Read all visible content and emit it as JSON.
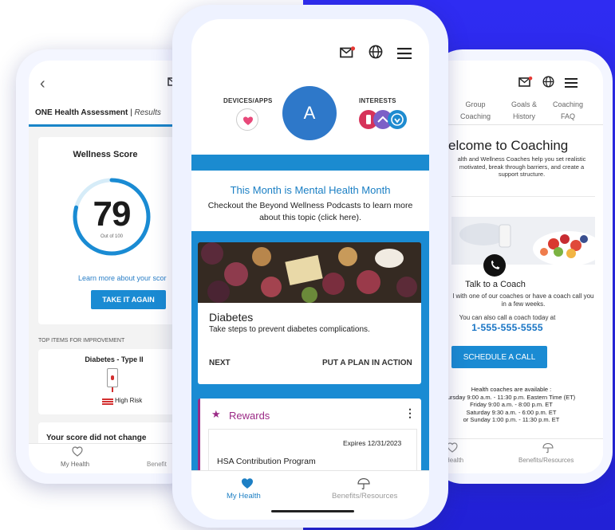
{
  "colors": {
    "brand_blue": "#1a8bd3",
    "background_blue": "#2f2cf2",
    "rewards_magenta": "#9b2a86",
    "risk_red": "#d32f2f"
  },
  "left_phone": {
    "title_main": "ONE Health Assessment",
    "title_sep": " | ",
    "title_sub": "Results",
    "wellness_title": "Wellness Score",
    "score": "79",
    "score_fraction": 0.79,
    "out_of": "Out of 100",
    "learn_more": "Learn more about your scor",
    "take_again": "TAKE IT AGAIN",
    "top_items": "TOP ITEMS FOR IMPROVEMENT",
    "diabetes_title": "Diabetes - Type II",
    "risk_label": "High Risk",
    "score_change": "Your score did not change",
    "nav": [
      "My Health",
      "Benefit"
    ]
  },
  "center_phone": {
    "devices_label": "DEVICES/APPS",
    "avatar_letter": "A",
    "interests_label": "INTERESTS",
    "month_title": "This Month is Mental Health Month",
    "month_desc": "Checkout the Beyond Wellness Podcasts to learn more about this topic (click here).",
    "card_title": "Diabetes",
    "card_desc": "Take steps to prevent diabetes complications.",
    "card_next": "NEXT",
    "card_plan": "PUT A PLAN IN ACTION",
    "rewards_title": "Rewards",
    "expires": "Expires 12/31/2023",
    "program": "HSA Contribution Program",
    "nav": [
      "My Health",
      "Benefits/Resources"
    ]
  },
  "right_phone": {
    "tabs": [
      [
        "Group",
        "Coaching"
      ],
      [
        "Goals &",
        "History"
      ],
      [
        "Coaching",
        "FAQ"
      ]
    ],
    "title": "elcome to Coaching",
    "desc": "alth and Wellness Coaches help you set realistic motivated, break through barriers, and create a support structure.",
    "talk_title": "Talk to a Coach",
    "talk_desc": "l with one of our coaches or have a coach call you in a few weeks.",
    "call_today": "You can also call a coach today at",
    "phone_number": "1-555-555-5555",
    "schedule": "SCHEDULE A CALL",
    "hours_title": "Health coaches are available :",
    "hours": [
      "ursday 9:00 a.m. - 11:30 p.m. Eastern Time (ET)",
      "Friday 9:00 a.m. - 8:00 p.m. ET",
      "Saturday 9:30 a.m. - 6:00 p.m. ET",
      "or Sunday 1:00 p.m. - 11:30 p.m. ET"
    ],
    "nav": [
      "Health",
      "Benefits/Resources"
    ]
  }
}
